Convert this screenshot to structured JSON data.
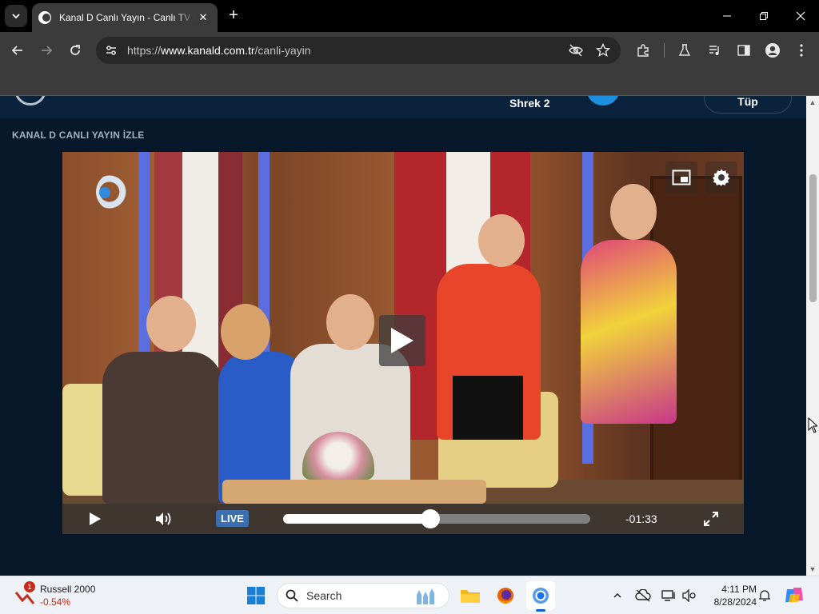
{
  "browser": {
    "tab": {
      "title": "Kanal D Canlı Yayın - Canlı TV İzle"
    },
    "address_bar": {
      "scheme": "https://",
      "domain": "www.kanald.com.tr",
      "path": "/canli-yayin"
    }
  },
  "page": {
    "top_strip": {
      "show_name": "Shrek 2",
      "pill_text": "Tüp"
    },
    "section_title": "KANAL D CANLI YAYIN İZLE"
  },
  "player": {
    "live_label": "LIVE",
    "time_remaining": "-01:33",
    "progress_fraction": 0.48
  },
  "taskbar": {
    "widget": {
      "name": "Russell 2000",
      "change": "-0.54%",
      "badge": "1"
    },
    "search_label": "Search",
    "clock": {
      "time": "4:11 PM",
      "date": "8/28/2024"
    }
  },
  "colors": {
    "page_bg": "#07182a",
    "live_badge": "#3b6fb0",
    "negative": "#c42b1c"
  }
}
